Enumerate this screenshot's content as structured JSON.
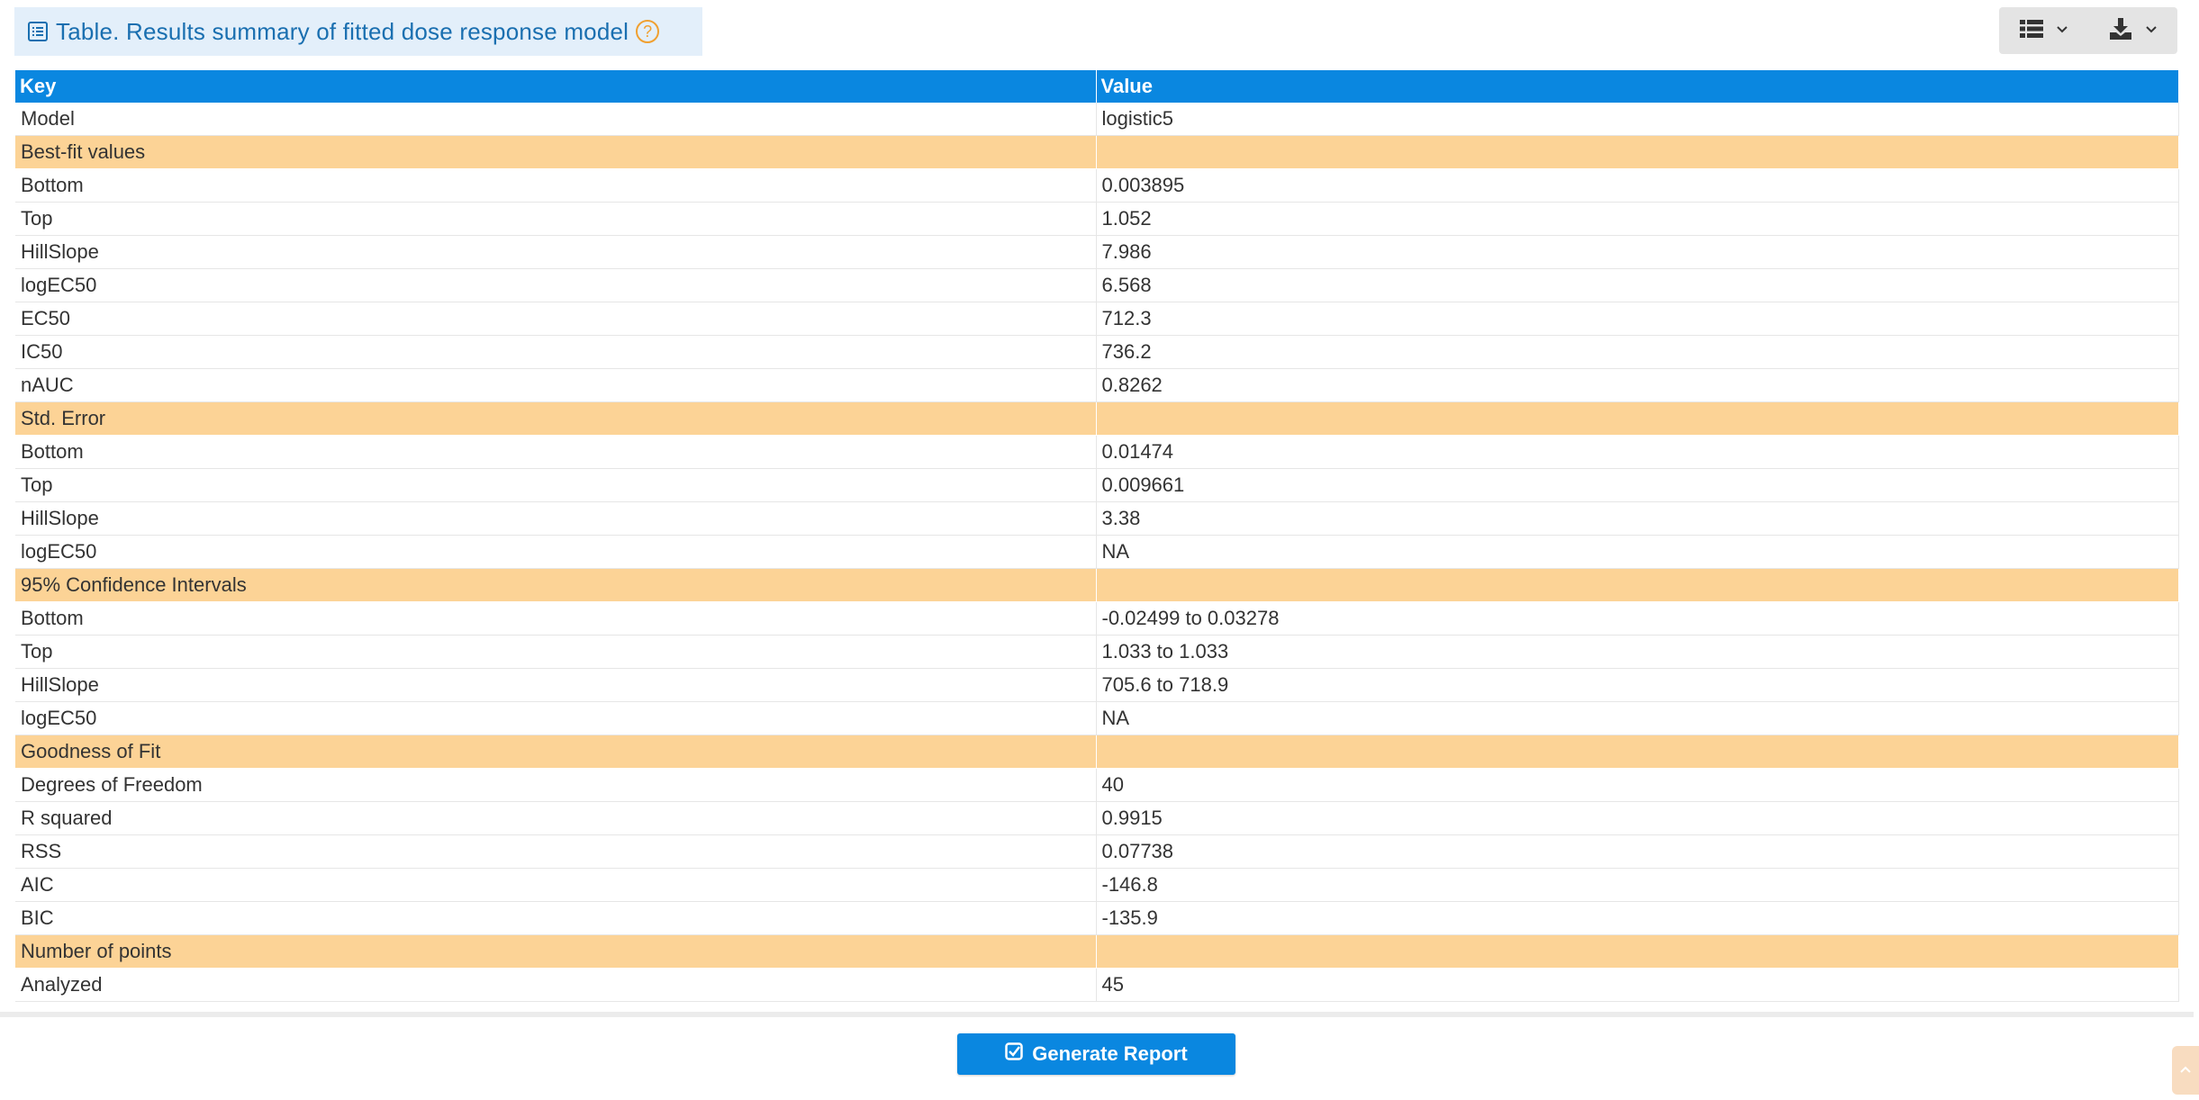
{
  "header": {
    "title": "Table. Results summary of fitted dose response model",
    "help_glyph": "?"
  },
  "toolbar": {
    "items": [
      {
        "icon": "table-view-icon"
      },
      {
        "icon": "download-icon"
      }
    ]
  },
  "table": {
    "columns": [
      "Key",
      "Value"
    ],
    "rows": [
      {
        "key": "Model",
        "value": "logistic5",
        "section": false
      },
      {
        "key": "Best-fit values",
        "value": "",
        "section": true
      },
      {
        "key": "Bottom",
        "value": "0.003895",
        "section": false
      },
      {
        "key": "Top",
        "value": "1.052",
        "section": false
      },
      {
        "key": "HillSlope",
        "value": "7.986",
        "section": false
      },
      {
        "key": "logEC50",
        "value": "6.568",
        "section": false
      },
      {
        "key": "EC50",
        "value": "712.3",
        "section": false
      },
      {
        "key": "IC50",
        "value": "736.2",
        "section": false
      },
      {
        "key": "nAUC",
        "value": "0.8262",
        "section": false
      },
      {
        "key": "Std. Error",
        "value": "",
        "section": true
      },
      {
        "key": "Bottom",
        "value": "0.01474",
        "section": false
      },
      {
        "key": "Top",
        "value": "0.009661",
        "section": false
      },
      {
        "key": "HillSlope",
        "value": "3.38",
        "section": false
      },
      {
        "key": "logEC50",
        "value": "NA",
        "section": false
      },
      {
        "key": "95% Confidence Intervals",
        "value": "",
        "section": true
      },
      {
        "key": "Bottom",
        "value": "-0.02499 to 0.03278",
        "section": false
      },
      {
        "key": "Top",
        "value": "1.033 to 1.033",
        "section": false
      },
      {
        "key": "HillSlope",
        "value": "705.6 to 718.9",
        "section": false
      },
      {
        "key": "logEC50",
        "value": "NA",
        "section": false
      },
      {
        "key": "Goodness of Fit",
        "value": "",
        "section": true
      },
      {
        "key": "Degrees of Freedom",
        "value": "40",
        "section": false
      },
      {
        "key": "R squared",
        "value": "0.9915",
        "section": false
      },
      {
        "key": "RSS",
        "value": "0.07738",
        "section": false
      },
      {
        "key": "AIC",
        "value": "-146.8",
        "section": false
      },
      {
        "key": "BIC",
        "value": "-135.9",
        "section": false
      },
      {
        "key": "Number of points",
        "value": "",
        "section": true
      },
      {
        "key": "Analyzed",
        "value": "45",
        "section": false
      }
    ]
  },
  "footer": {
    "generate_report_label": "Generate Report"
  },
  "colors": {
    "header_blue": "#0a87e0",
    "section_orange": "#fcd396",
    "title_blue": "#1a6fb0",
    "title_bg": "#e3effa",
    "help_orange": "#f0a030"
  }
}
